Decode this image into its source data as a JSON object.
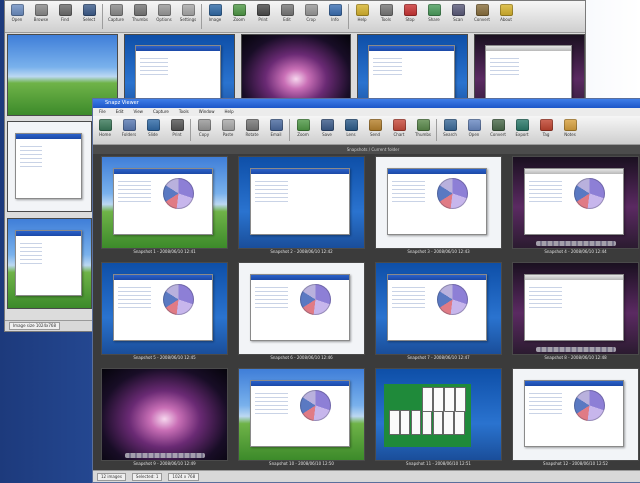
{
  "colors": {
    "dock_accent": "#1c56c8",
    "toolbar_bg": "#d9d9d9",
    "grid_bg": "#3b3b3b"
  },
  "back_window": {
    "toolbar": [
      {
        "label": "Open",
        "icon": "folder-icon",
        "color": "#6d8fc4"
      },
      {
        "label": "Browse",
        "icon": "browse-icon",
        "color": "#8a8a8a"
      },
      {
        "label": "Find",
        "icon": "find-icon",
        "color": "#6c6c6c"
      },
      {
        "label": "Select",
        "icon": "cursor-icon",
        "color": "#3c5c8c"
      },
      {
        "label": "Capture",
        "icon": "monitor-icon",
        "color": "#8c8c8c"
      },
      {
        "label": "Thumbs",
        "icon": "grid-icon",
        "color": "#777"
      },
      {
        "label": "Options",
        "icon": "options-icon",
        "color": "#999"
      },
      {
        "label": "Settings",
        "icon": "gear-icon",
        "color": "#aaa"
      },
      {
        "label": "Image",
        "icon": "image-icon",
        "color": "#2f6aa8"
      },
      {
        "label": "Zoom",
        "icon": "zoom-icon",
        "color": "#4f9a46"
      },
      {
        "label": "Print",
        "icon": "print-icon",
        "color": "#4a4a4a"
      },
      {
        "label": "Edit",
        "icon": "pencil-icon",
        "color": "#777"
      },
      {
        "label": "Crop",
        "icon": "crop-icon",
        "color": "#999"
      },
      {
        "label": "Info",
        "icon": "info-icon",
        "color": "#3a6fb4"
      },
      {
        "label": "Help",
        "icon": "help-icon",
        "color": "#d9b52c"
      },
      {
        "label": "Tools",
        "icon": "wrench-icon",
        "color": "#777"
      },
      {
        "label": "Stop",
        "icon": "stop-icon",
        "color": "#c33"
      },
      {
        "label": "Share",
        "icon": "share-icon",
        "color": "#4a9e5c"
      },
      {
        "label": "Scan",
        "icon": "scan-icon",
        "color": "#5a5a7a"
      },
      {
        "label": "Convert",
        "icon": "convert-icon",
        "color": "#8a6f3c"
      },
      {
        "label": "About",
        "icon": "about-icon",
        "color": "#d9b52c"
      }
    ],
    "top_thumbs": [
      {
        "wall": "wp-xp",
        "app": false,
        "pie": false
      },
      {
        "wall": "wp-blue",
        "app": true,
        "pie": false
      },
      {
        "wall": "wp-dark",
        "app": false,
        "pie": false
      },
      {
        "wall": "wp-blue",
        "app": true,
        "pie": false
      },
      {
        "wall": "wp-mac",
        "app": true,
        "pie": false
      }
    ],
    "left_thumbs": [
      {
        "wall": "wp-white",
        "app": true,
        "pie": false,
        "caption": ""
      },
      {
        "wall": "wp-xp",
        "app": true,
        "pie": false,
        "caption": ""
      }
    ],
    "status": "Image size 1024x768"
  },
  "front_window": {
    "title": "Snapz Viewer",
    "menu": [
      "File",
      "Edit",
      "View",
      "Capture",
      "Tools",
      "Window",
      "Help"
    ],
    "toolbar": [
      {
        "label": "Home",
        "icon": "home-icon",
        "color": "#3a7a5a"
      },
      {
        "label": "Folders",
        "icon": "folder-icon",
        "color": "#5a7ab4"
      },
      {
        "label": "Slide",
        "icon": "slideshow-icon",
        "color": "#2f6aa8"
      },
      {
        "label": "Print",
        "icon": "print-icon",
        "color": "#555"
      },
      {
        "label": "Copy",
        "icon": "copy-icon",
        "color": "#999"
      },
      {
        "label": "Paste",
        "icon": "paste-icon",
        "color": "#aaa"
      },
      {
        "label": "Rotate",
        "icon": "rotate-icon",
        "color": "#777"
      },
      {
        "label": "Email",
        "icon": "email-icon",
        "color": "#4a6aa0"
      },
      {
        "label": "Zoom",
        "icon": "zoom-icon",
        "color": "#4f9a46"
      },
      {
        "label": "Save",
        "icon": "save-icon",
        "color": "#3a5a8a"
      },
      {
        "label": "Lens",
        "icon": "lens-icon",
        "color": "#2a5a8a"
      },
      {
        "label": "Send",
        "icon": "send-icon",
        "color": "#b8822c"
      },
      {
        "label": "Chart",
        "icon": "chart-icon",
        "color": "#c94a3a"
      },
      {
        "label": "Thumbs",
        "icon": "thumbs-icon",
        "color": "#5a8a4a"
      },
      {
        "label": "Search",
        "icon": "search-icon",
        "color": "#3a6a9a"
      },
      {
        "label": "Open",
        "icon": "open-icon",
        "color": "#6a8ac4"
      },
      {
        "label": "Convert",
        "icon": "convert-icon",
        "color": "#4a6a4a"
      },
      {
        "label": "Export",
        "icon": "export-icon",
        "color": "#2a7a6a"
      },
      {
        "label": "Tag",
        "icon": "tag-icon",
        "color": "#c2432e"
      },
      {
        "label": "Notes",
        "icon": "notes-icon",
        "color": "#d9a13c"
      }
    ],
    "grid": [
      {
        "wall": "wp-xp",
        "app": true,
        "pie": true,
        "caption": "Snapshot 1 - 2008/06/10 12:41"
      },
      {
        "wall": "wp-blue",
        "app": true,
        "pie": false,
        "caption": "Snapshot 2 - 2008/06/10 12:42"
      },
      {
        "wall": "wp-white",
        "app": true,
        "pie": true,
        "caption": "Snapshot 3 - 2008/06/10 12:43"
      },
      {
        "wall": "wp-mac",
        "app": true,
        "pie": true,
        "caption": "Snapshot 4 - 2008/06/10 12:44"
      },
      {
        "wall": "wp-blue",
        "app": true,
        "pie": true,
        "caption": "Snapshot 5 - 2008/06/10 12:45"
      },
      {
        "wall": "wp-white",
        "app": true,
        "pie": true,
        "caption": "Snapshot 6 - 2008/06/10 12:46"
      },
      {
        "wall": "wp-blue",
        "app": true,
        "pie": true,
        "caption": "Snapshot 7 - 2008/06/10 12:47"
      },
      {
        "wall": "wp-mac",
        "app": true,
        "pie": false,
        "caption": "Snapshot 8 - 2008/06/10 12:48"
      },
      {
        "wall": "wp-dark",
        "app": false,
        "pie": false,
        "caption": "Snapshot 9 - 2008/06/10 12:49"
      },
      {
        "wall": "wp-xp",
        "app": true,
        "pie": true,
        "caption": "Snapshot 10 - 2008/06/10 12:50"
      },
      {
        "wall": "wp-blue",
        "app": false,
        "pie": false,
        "cards": true,
        "caption": "Snapshot 11 - 2008/06/10 12:51"
      },
      {
        "wall": "wp-white",
        "app": true,
        "pie": true,
        "caption": "Snapshot 12 - 2008/06/10 12:52"
      }
    ],
    "grid_header": "Snapshots / Current folder",
    "status": [
      "12 images",
      "Selected: 1",
      "1024 x 768"
    ]
  }
}
